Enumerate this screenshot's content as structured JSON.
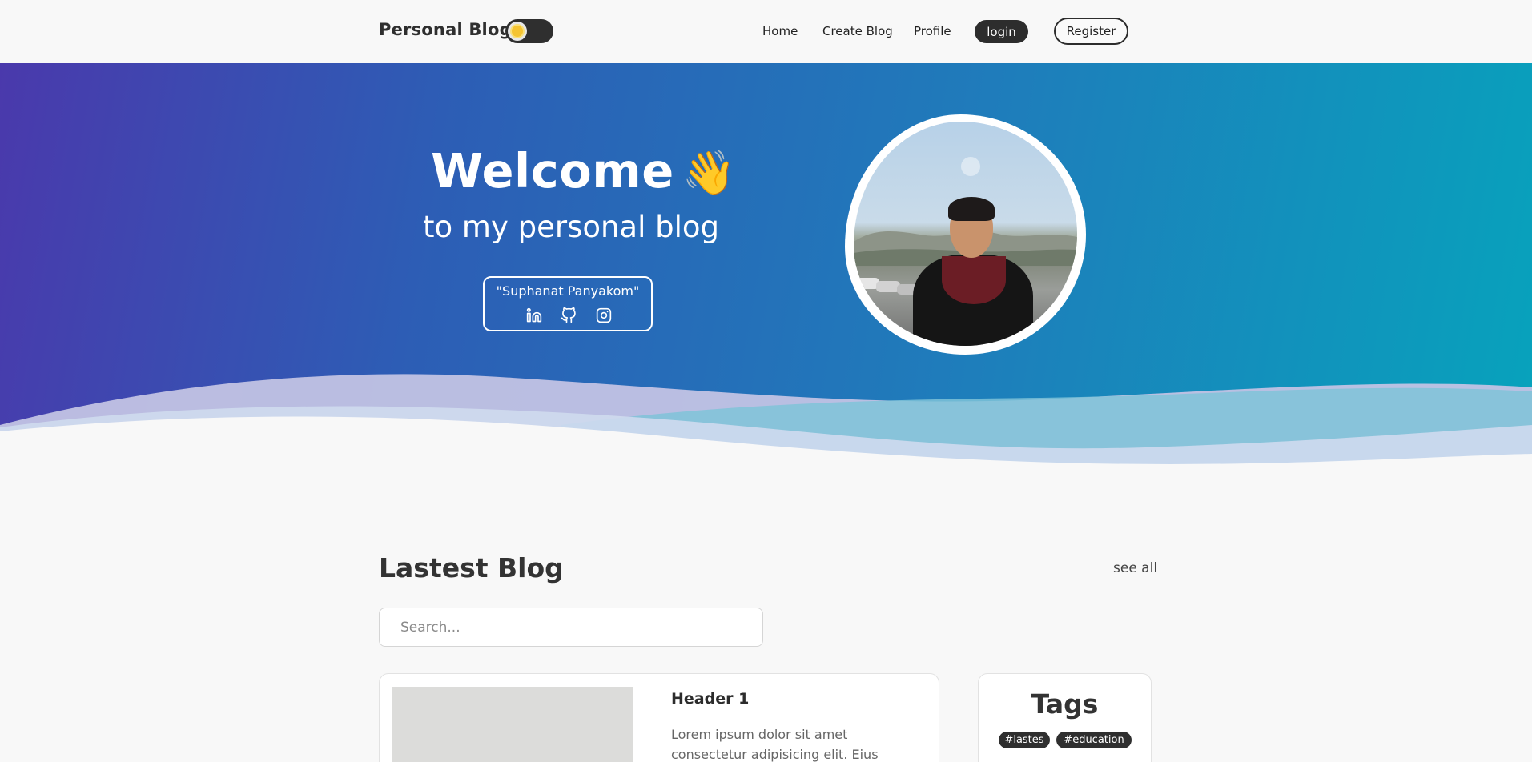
{
  "navbar": {
    "brand": "Personal Blog",
    "links": [
      "Home",
      "Create Blog",
      "Profile"
    ],
    "login_label": "login",
    "register_label": "Register"
  },
  "hero": {
    "title": "Welcome",
    "title_emoji": "👋",
    "subtitle": "to my personal blog",
    "name": "\"Suphanat Panyakom\"",
    "social_icons": [
      "linkedin-icon",
      "github-icon",
      "instagram-icon"
    ]
  },
  "latest": {
    "heading": "Lastest Blog",
    "see_all_label": "see all",
    "search_placeholder": "Search...",
    "posts": [
      {
        "title": "Header 1",
        "excerpt": "Lorem ipsum dolor sit amet consectetur adipisicing elit. Eius"
      }
    ]
  },
  "tags": {
    "heading": "Tags",
    "items": [
      "#lastes",
      "#education"
    ]
  },
  "colors": {
    "hero_gradient_start": "#4a39ac",
    "hero_gradient_end": "#07a3bc",
    "dark": "#2d2d2d",
    "background": "#f8f8f8"
  }
}
